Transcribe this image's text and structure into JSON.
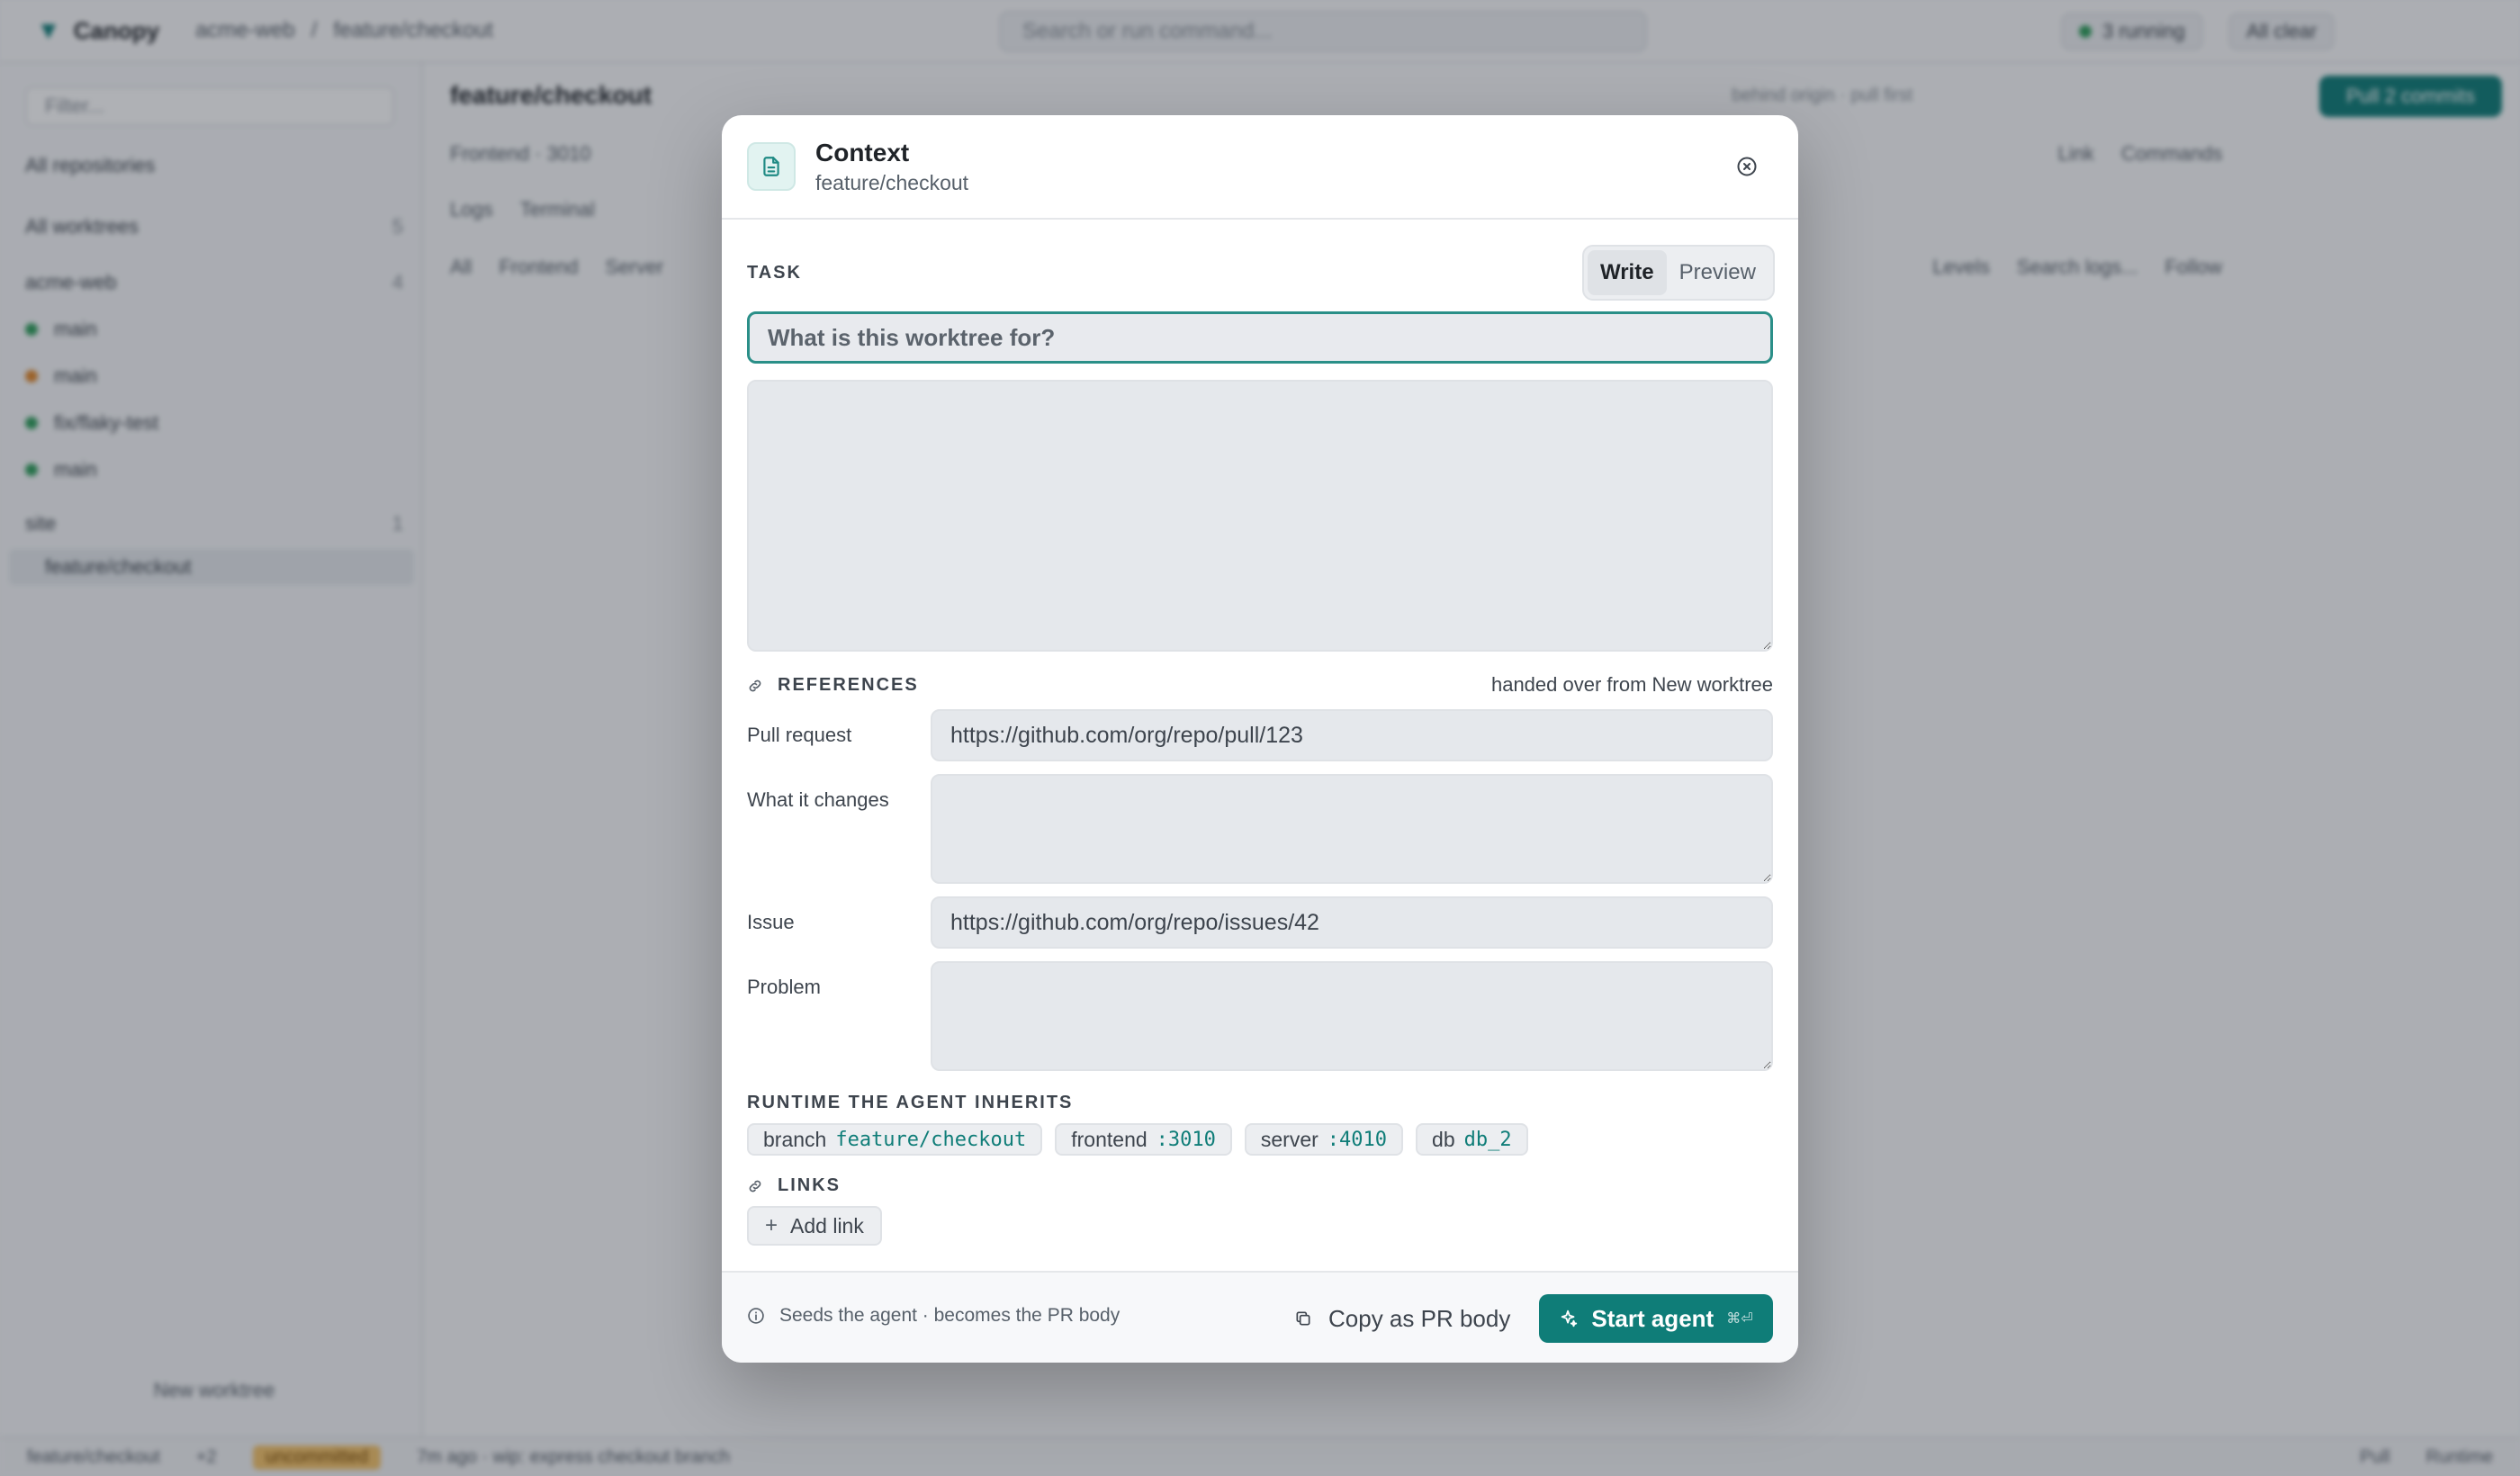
{
  "background": {
    "app_name": "Canopy",
    "crumbs": [
      "acme-web",
      "/",
      "feature/checkout"
    ],
    "search_placeholder": "Search or run command...",
    "running": "3 running",
    "all_clear": "All clear",
    "sidebar": {
      "filter_placeholder": "Filter...",
      "all_repos": "All repositories",
      "all_worktrees": "All worktrees",
      "all_worktrees_count": "5",
      "group1": "acme-web",
      "group1_count": "4",
      "items": [
        "main",
        "main",
        "fix/flaky-test",
        "main"
      ],
      "group2": "site",
      "group2_count": "1",
      "selected": "feature/checkout",
      "new_worktree": "New worktree"
    },
    "main": {
      "title": "feature/checkout",
      "status": "behind origin · pull first",
      "primary_button": "Pull 2 commits",
      "service_tab": "Frontend · 3010",
      "tab_logs": "Logs",
      "tab_terminal": "Terminal",
      "link_btn": "Link",
      "commands_btn": "Commands",
      "filter_all": "All",
      "filter_frontend": "Frontend",
      "filter_server": "Server",
      "levels": "Levels",
      "search_logs": "Search logs...",
      "follow": "Follow"
    },
    "statusbar": {
      "branch": "feature/checkout",
      "ahead": "+2",
      "uncommitted": "uncommitted",
      "last_commit": "7m ago · wip: express checkout branch",
      "pull": "Pull",
      "runtime": "Runtime"
    }
  },
  "modal": {
    "title": "Context",
    "subtitle": "feature/checkout",
    "task_label": "TASK",
    "mode_write": "Write",
    "mode_preview": "Preview",
    "task_placeholder": "What is this worktree for?",
    "task_body": "",
    "references_label": "REFERENCES",
    "handed_over": "handed over from New worktree",
    "references": [
      {
        "label": "Pull request",
        "value": "https://github.com/org/repo/pull/123"
      },
      {
        "label": "What it changes",
        "value": ""
      },
      {
        "label": "Issue",
        "value": "https://github.com/org/repo/issues/42"
      },
      {
        "label": "Problem",
        "value": ""
      }
    ],
    "runtime_label": "RUNTIME THE AGENT INHERITS",
    "runtime": [
      {
        "key": "branch",
        "value": "feature/checkout"
      },
      {
        "key": "frontend",
        "value": ":3010"
      },
      {
        "key": "server",
        "value": ":4010"
      },
      {
        "key": "db",
        "value": "db_2"
      }
    ],
    "links_label": "LINKS",
    "add_link": "Add link",
    "footer_hint": "Seeds the agent · becomes the PR body",
    "copy_button": "Copy as PR body",
    "start_button": "Start agent",
    "start_shortcut": "⌘⏎"
  },
  "colors": {
    "accent": "#0f7d78",
    "accent_focus": "#2a8f88",
    "status_green": "#2e9e5b",
    "status_orange": "#e0872b"
  }
}
